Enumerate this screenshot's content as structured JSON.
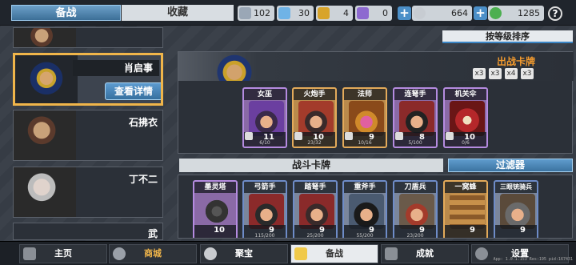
{
  "tabs": {
    "active": "备战",
    "inactive": "收藏"
  },
  "resources": [
    {
      "name": "shield",
      "value": "102",
      "color": "#9aa7b6"
    },
    {
      "name": "gem-blue",
      "value": "30",
      "color": "#6fb3e6"
    },
    {
      "name": "shield-gold",
      "value": "4",
      "color": "#d8a42a"
    },
    {
      "name": "shield-purple",
      "value": "0",
      "color": "#8d6ad0"
    },
    {
      "name": "silver-coin",
      "value": "664",
      "color": "#c7ccd2"
    },
    {
      "name": "green-gem",
      "value": "1285",
      "color": "#4caf50"
    }
  ],
  "help": "?",
  "heroes": {
    "selected": {
      "name": "肖启事",
      "detail": "查看详情"
    },
    "list": [
      "石拂衣",
      "丁不二",
      "武"
    ]
  },
  "sort_label": "按等级排序",
  "lineup": {
    "title": "出战卡牌",
    "icons": [
      "x3",
      "x3",
      "x4",
      "x3"
    ],
    "cards": [
      {
        "name": "女巫",
        "level": "11",
        "progress": "6/10"
      },
      {
        "name": "火炮手",
        "level": "10",
        "progress": "23/32"
      },
      {
        "name": "法师",
        "level": "9",
        "progress": "10/16"
      },
      {
        "name": "连弩手",
        "level": "8",
        "progress": "5/100"
      },
      {
        "name": "机关伞",
        "level": "10",
        "progress": "0/6"
      }
    ]
  },
  "battle": {
    "title": "战斗卡牌",
    "filter": "过滤器",
    "cards": [
      {
        "name": "墨灵塔",
        "level": "10",
        "progress": ""
      },
      {
        "name": "弓箭手",
        "level": "9",
        "progress": "115/200"
      },
      {
        "name": "踏弩手",
        "level": "9",
        "progress": "25/200"
      },
      {
        "name": "重斧手",
        "level": "9",
        "progress": "55/200"
      },
      {
        "name": "刀盾兵",
        "level": "9",
        "progress": "23/200"
      },
      {
        "name": "一窝蜂",
        "level": "9",
        "progress": ""
      },
      {
        "name": "三眼铳骑兵",
        "level": "9",
        "progress": ""
      }
    ]
  },
  "nav": [
    {
      "label": "主页"
    },
    {
      "label": "商城"
    },
    {
      "label": "聚宝"
    },
    {
      "label": "备战"
    },
    {
      "label": "成就"
    },
    {
      "label": "设置"
    }
  ],
  "version": "App: 1.0.1.153 Res:195 pid:167431"
}
